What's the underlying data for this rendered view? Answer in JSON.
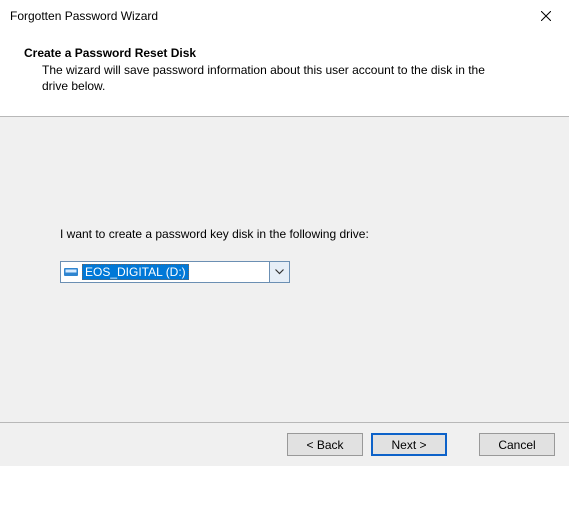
{
  "title": "Forgotten Password Wizard",
  "header": {
    "title": "Create a Password Reset Disk",
    "description": "The wizard will save password information about this user account to the disk in the drive below."
  },
  "body": {
    "prompt": "I want to create a password key disk in the following drive:",
    "drive_selected": "EOS_DIGITAL (D:)"
  },
  "buttons": {
    "back": "< Back",
    "next": "Next >",
    "cancel": "Cancel"
  }
}
